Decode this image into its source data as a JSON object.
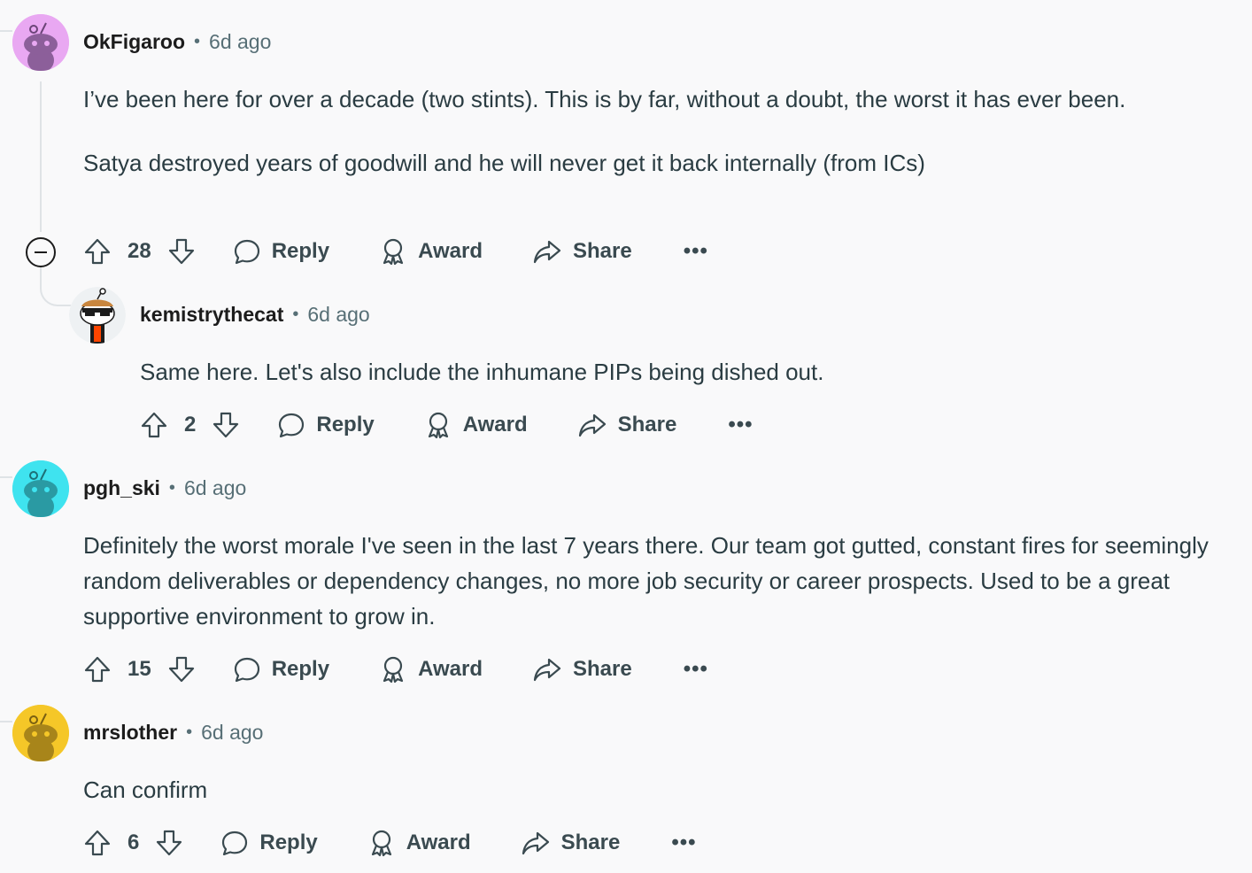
{
  "comments": [
    {
      "username": "OkFigaroo",
      "separator": "•",
      "time": "6d ago",
      "paragraphs": [
        "I’ve been here for over a decade (two stints). This is by far, without a doubt, the worst it has ever been.",
        "Satya destroyed years of goodwill and he will never get it back internally (from ICs)"
      ],
      "votes": "28",
      "avatar_color": "#e9a8f2"
    },
    {
      "username": "kemistrythecat",
      "separator": "•",
      "time": "6d ago",
      "paragraphs": [
        "Same here. Let's also include the inhumane PIPs being dished out."
      ],
      "votes": "2",
      "avatar_color": "#ffffff"
    },
    {
      "username": "pgh_ski",
      "separator": "•",
      "time": "6d ago",
      "paragraphs": [
        "Definitely the worst morale I've seen in the last 7 years there. Our team got gutted, constant fires for seemingly random deliverables or dependency changes, no more job security or career prospects. Used to be a great supportive environment to grow in."
      ],
      "votes": "15",
      "avatar_color": "#3fe3ef"
    },
    {
      "username": "mrslother",
      "separator": "•",
      "time": "6d ago",
      "paragraphs": [
        "Can confirm"
      ],
      "votes": "6",
      "avatar_color": "#f5c728"
    }
  ],
  "actions": {
    "reply": "Reply",
    "award": "Award",
    "share": "Share",
    "more": "•••"
  }
}
